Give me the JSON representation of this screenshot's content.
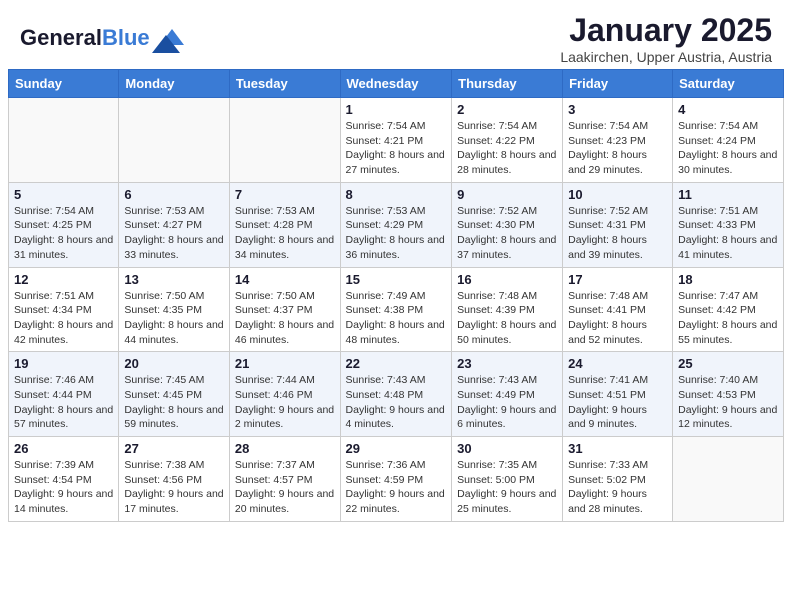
{
  "header": {
    "logo_line1": "General",
    "logo_line2": "Blue",
    "title": "January 2025",
    "subtitle": "Laakirchen, Upper Austria, Austria"
  },
  "weekdays": [
    "Sunday",
    "Monday",
    "Tuesday",
    "Wednesday",
    "Thursday",
    "Friday",
    "Saturday"
  ],
  "weeks": [
    {
      "shaded": false,
      "days": [
        {
          "num": "",
          "info": ""
        },
        {
          "num": "",
          "info": ""
        },
        {
          "num": "",
          "info": ""
        },
        {
          "num": "1",
          "info": "Sunrise: 7:54 AM\nSunset: 4:21 PM\nDaylight: 8 hours and 27 minutes."
        },
        {
          "num": "2",
          "info": "Sunrise: 7:54 AM\nSunset: 4:22 PM\nDaylight: 8 hours and 28 minutes."
        },
        {
          "num": "3",
          "info": "Sunrise: 7:54 AM\nSunset: 4:23 PM\nDaylight: 8 hours and 29 minutes."
        },
        {
          "num": "4",
          "info": "Sunrise: 7:54 AM\nSunset: 4:24 PM\nDaylight: 8 hours and 30 minutes."
        }
      ]
    },
    {
      "shaded": true,
      "days": [
        {
          "num": "5",
          "info": "Sunrise: 7:54 AM\nSunset: 4:25 PM\nDaylight: 8 hours and 31 minutes."
        },
        {
          "num": "6",
          "info": "Sunrise: 7:53 AM\nSunset: 4:27 PM\nDaylight: 8 hours and 33 minutes."
        },
        {
          "num": "7",
          "info": "Sunrise: 7:53 AM\nSunset: 4:28 PM\nDaylight: 8 hours and 34 minutes."
        },
        {
          "num": "8",
          "info": "Sunrise: 7:53 AM\nSunset: 4:29 PM\nDaylight: 8 hours and 36 minutes."
        },
        {
          "num": "9",
          "info": "Sunrise: 7:52 AM\nSunset: 4:30 PM\nDaylight: 8 hours and 37 minutes."
        },
        {
          "num": "10",
          "info": "Sunrise: 7:52 AM\nSunset: 4:31 PM\nDaylight: 8 hours and 39 minutes."
        },
        {
          "num": "11",
          "info": "Sunrise: 7:51 AM\nSunset: 4:33 PM\nDaylight: 8 hours and 41 minutes."
        }
      ]
    },
    {
      "shaded": false,
      "days": [
        {
          "num": "12",
          "info": "Sunrise: 7:51 AM\nSunset: 4:34 PM\nDaylight: 8 hours and 42 minutes."
        },
        {
          "num": "13",
          "info": "Sunrise: 7:50 AM\nSunset: 4:35 PM\nDaylight: 8 hours and 44 minutes."
        },
        {
          "num": "14",
          "info": "Sunrise: 7:50 AM\nSunset: 4:37 PM\nDaylight: 8 hours and 46 minutes."
        },
        {
          "num": "15",
          "info": "Sunrise: 7:49 AM\nSunset: 4:38 PM\nDaylight: 8 hours and 48 minutes."
        },
        {
          "num": "16",
          "info": "Sunrise: 7:48 AM\nSunset: 4:39 PM\nDaylight: 8 hours and 50 minutes."
        },
        {
          "num": "17",
          "info": "Sunrise: 7:48 AM\nSunset: 4:41 PM\nDaylight: 8 hours and 52 minutes."
        },
        {
          "num": "18",
          "info": "Sunrise: 7:47 AM\nSunset: 4:42 PM\nDaylight: 8 hours and 55 minutes."
        }
      ]
    },
    {
      "shaded": true,
      "days": [
        {
          "num": "19",
          "info": "Sunrise: 7:46 AM\nSunset: 4:44 PM\nDaylight: 8 hours and 57 minutes."
        },
        {
          "num": "20",
          "info": "Sunrise: 7:45 AM\nSunset: 4:45 PM\nDaylight: 8 hours and 59 minutes."
        },
        {
          "num": "21",
          "info": "Sunrise: 7:44 AM\nSunset: 4:46 PM\nDaylight: 9 hours and 2 minutes."
        },
        {
          "num": "22",
          "info": "Sunrise: 7:43 AM\nSunset: 4:48 PM\nDaylight: 9 hours and 4 minutes."
        },
        {
          "num": "23",
          "info": "Sunrise: 7:43 AM\nSunset: 4:49 PM\nDaylight: 9 hours and 6 minutes."
        },
        {
          "num": "24",
          "info": "Sunrise: 7:41 AM\nSunset: 4:51 PM\nDaylight: 9 hours and 9 minutes."
        },
        {
          "num": "25",
          "info": "Sunrise: 7:40 AM\nSunset: 4:53 PM\nDaylight: 9 hours and 12 minutes."
        }
      ]
    },
    {
      "shaded": false,
      "days": [
        {
          "num": "26",
          "info": "Sunrise: 7:39 AM\nSunset: 4:54 PM\nDaylight: 9 hours and 14 minutes."
        },
        {
          "num": "27",
          "info": "Sunrise: 7:38 AM\nSunset: 4:56 PM\nDaylight: 9 hours and 17 minutes."
        },
        {
          "num": "28",
          "info": "Sunrise: 7:37 AM\nSunset: 4:57 PM\nDaylight: 9 hours and 20 minutes."
        },
        {
          "num": "29",
          "info": "Sunrise: 7:36 AM\nSunset: 4:59 PM\nDaylight: 9 hours and 22 minutes."
        },
        {
          "num": "30",
          "info": "Sunrise: 7:35 AM\nSunset: 5:00 PM\nDaylight: 9 hours and 25 minutes."
        },
        {
          "num": "31",
          "info": "Sunrise: 7:33 AM\nSunset: 5:02 PM\nDaylight: 9 hours and 28 minutes."
        },
        {
          "num": "",
          "info": ""
        }
      ]
    }
  ]
}
